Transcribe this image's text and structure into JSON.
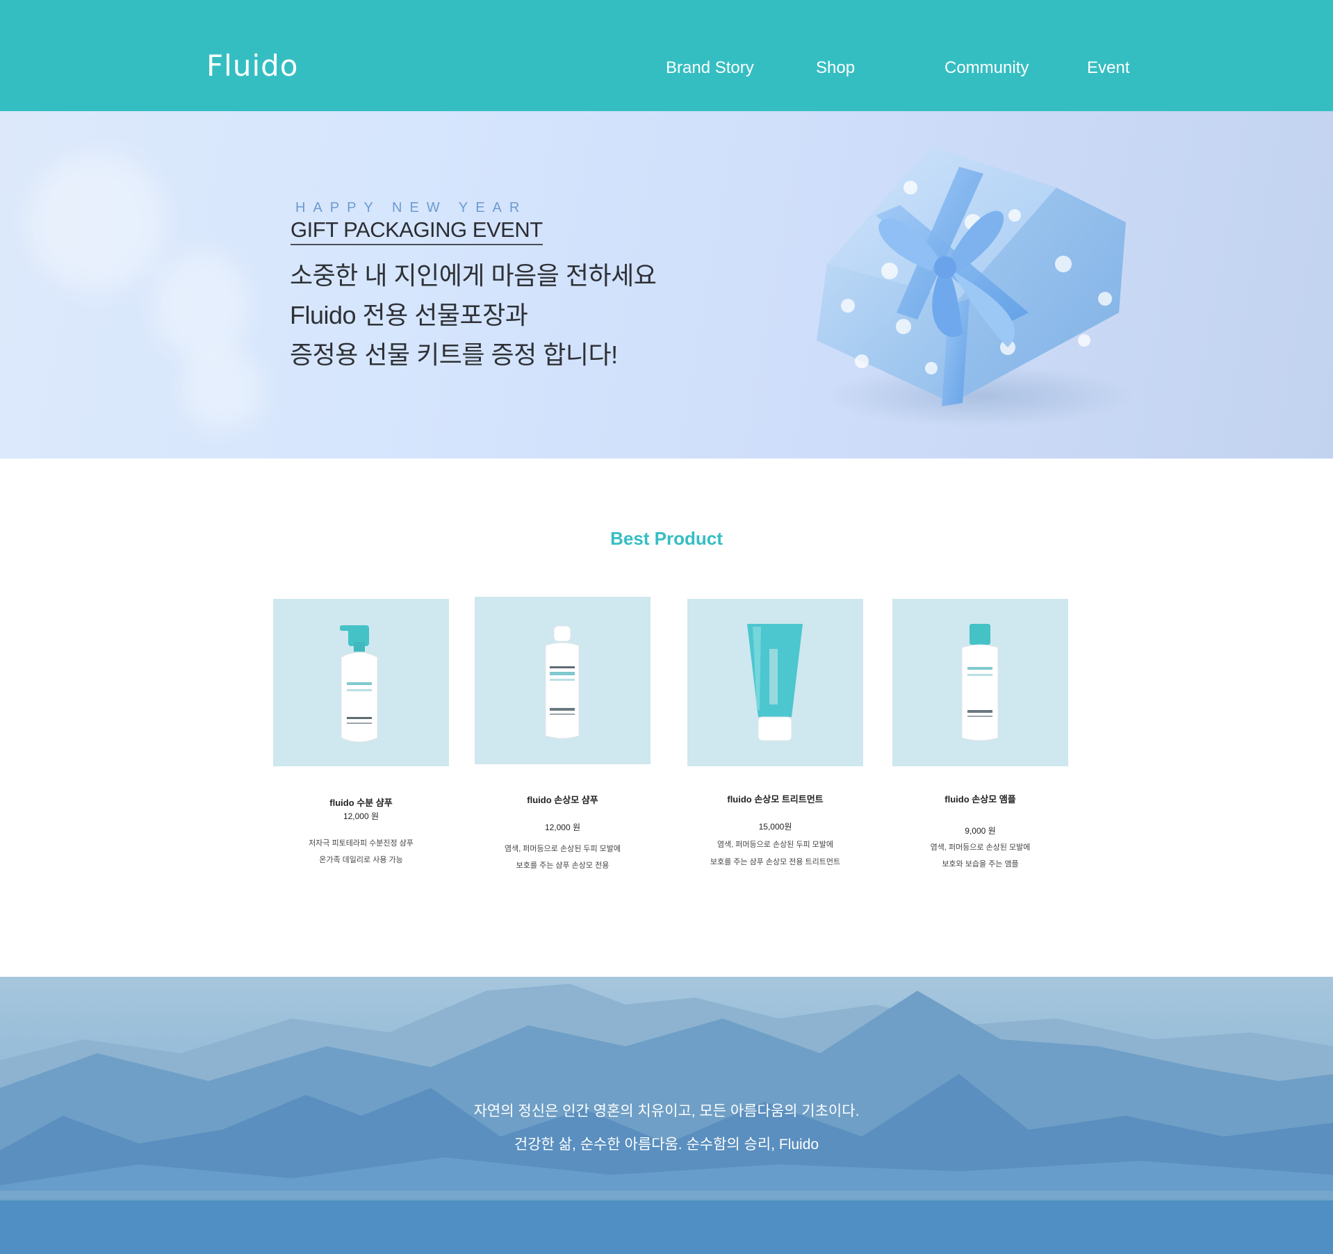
{
  "header": {
    "logo": "Fluido",
    "nav": [
      "Brand Story",
      "Shop",
      "Community",
      "Event"
    ]
  },
  "hero": {
    "eyebrow": "HAPPY NEW YEAR",
    "title": "GIFT PACKAGING EVENT",
    "lines": [
      "소중한 내 지인에게 마음을 전하세요",
      "Fluido 전용 선물포장과",
      "증정용 선물 키트를 증정 합니다!"
    ]
  },
  "best": {
    "title": "Best Product",
    "products": [
      {
        "name": "fluido 수분 샴푸",
        "price": "12,000 원",
        "desc": [
          "저자극 피토테라피 수분진정 샴푸",
          "온가족 데일리로 사용 가능"
        ],
        "image": "shampoo-pump-bottle"
      },
      {
        "name": "fluido 손상모 샴푸",
        "price": "12,000 원",
        "desc": [
          "염색, 퍼머등으로 손상된 두피 모발에",
          "보호를 주는 샴푸 손상모 전용"
        ],
        "image": "shampoo-bottle"
      },
      {
        "name": "fluido 손상모 트리트먼트",
        "price": "15,000원",
        "desc": [
          "염색, 퍼머등으로 손상된 두피 모발에",
          "보호를 주는 샴푸 손상모 전용 트리트먼트"
        ],
        "image": "treatment-tube"
      },
      {
        "name": "fluido 손상모 앰플",
        "price": "9,000 원",
        "desc": [
          "염색, 퍼머등으로 손상된  모발에",
          "보호와 보습을 주는 앰플"
        ],
        "image": "ampoule-bottle"
      }
    ]
  },
  "footer": {
    "lines": [
      "자연의 정신은 인간 영혼의 치유이고, 모든 아름다움의 기초이다.",
      "건강한 삶, 순수한 아름다움. 순수함의 승리, Fluido"
    ]
  },
  "colors": {
    "brand": "#35bec2",
    "thumb": "#cfe7ef",
    "hero_bg": "#d6e6fd"
  }
}
